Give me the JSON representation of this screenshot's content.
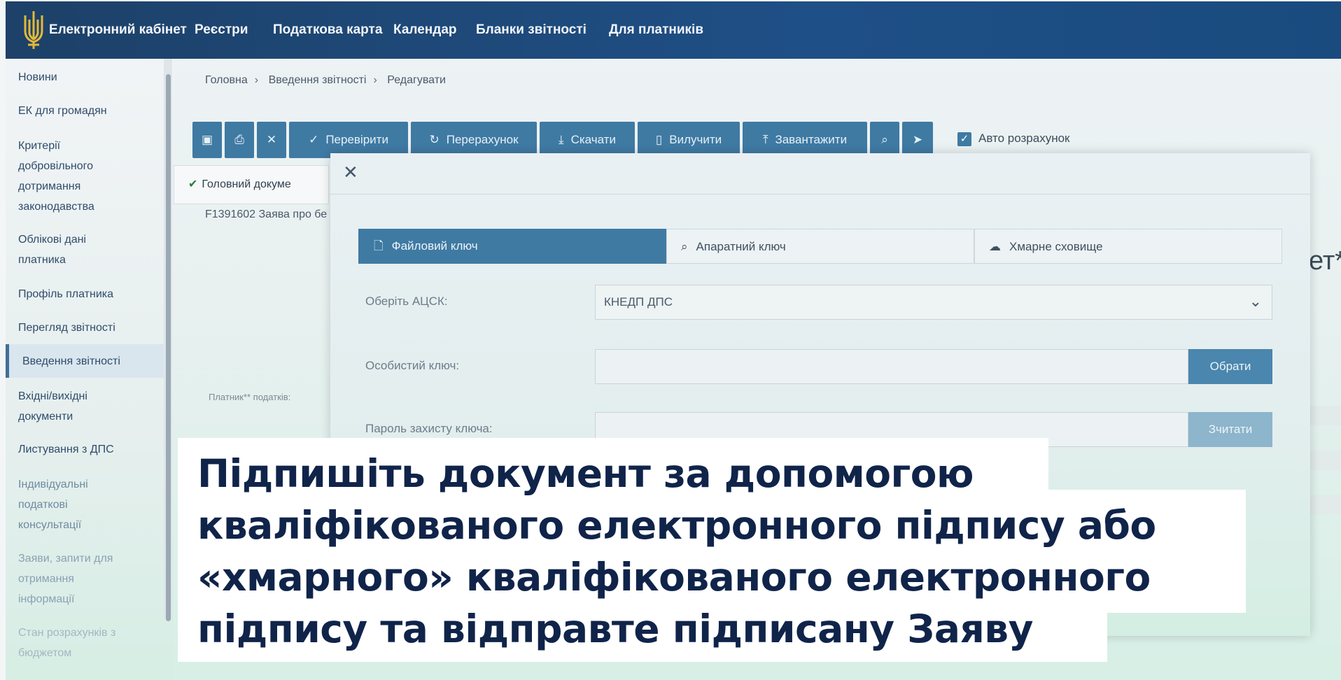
{
  "topnav": {
    "logo_icon": "trident-icon",
    "items": [
      "Електронний кабінет",
      "Реєстри",
      "Податкова карта",
      "Календар",
      "Бланки звітності",
      "Для платників"
    ]
  },
  "sidebar": {
    "items": [
      "Новини",
      "ЕК для громадян",
      "Критерії добровільного дотримання законодавства",
      "Облікові дані платника",
      "Профіль платника",
      "Перегляд звітності",
      "Введення звітності",
      "Вхідні/вихідні документи",
      "Листування з ДПС",
      "Індивідуальні податкові консультації",
      "Заяви, запити для отримання інформації",
      "Стан розрахунків з бюджетом"
    ],
    "active": "Введення звітності"
  },
  "breadcrumb": [
    "Головна",
    "Введення звітності",
    "Редагувати"
  ],
  "toolbar": {
    "buttons": [
      "Перевірити",
      "Перерахунок",
      "Скачати",
      "Вилучити",
      "Завантажити"
    ],
    "auto_calc_label": "Авто розрахунок",
    "accent": "#3f7aa3"
  },
  "document": {
    "main_tab": "Головний докуме",
    "name": "F1391602 Заява про бе",
    "payer_label": "Платник** податків:"
  },
  "modal": {
    "tabs": [
      "Файловий ключ",
      "Апаратний ключ",
      "Хмарне сховище"
    ],
    "active_tab": "Файловий ключ",
    "acsk_label": "Оберіть АЦСК:",
    "acsk_value": "КНЕДП ДПС",
    "key_label": "Особистий ключ:",
    "choose_button": "Обрати",
    "password_label": "Пароль захисту ключа:",
    "read_button": "Зчитати"
  },
  "caption": {
    "lines": [
      "Підпишіть документ за допомогою",
      "кваліфікованого електронного підпису або",
      "«хмарного» кваліфікованого електронного",
      "підпису та відправте підписану Заяву"
    ]
  },
  "right_edge_text": "ет*"
}
